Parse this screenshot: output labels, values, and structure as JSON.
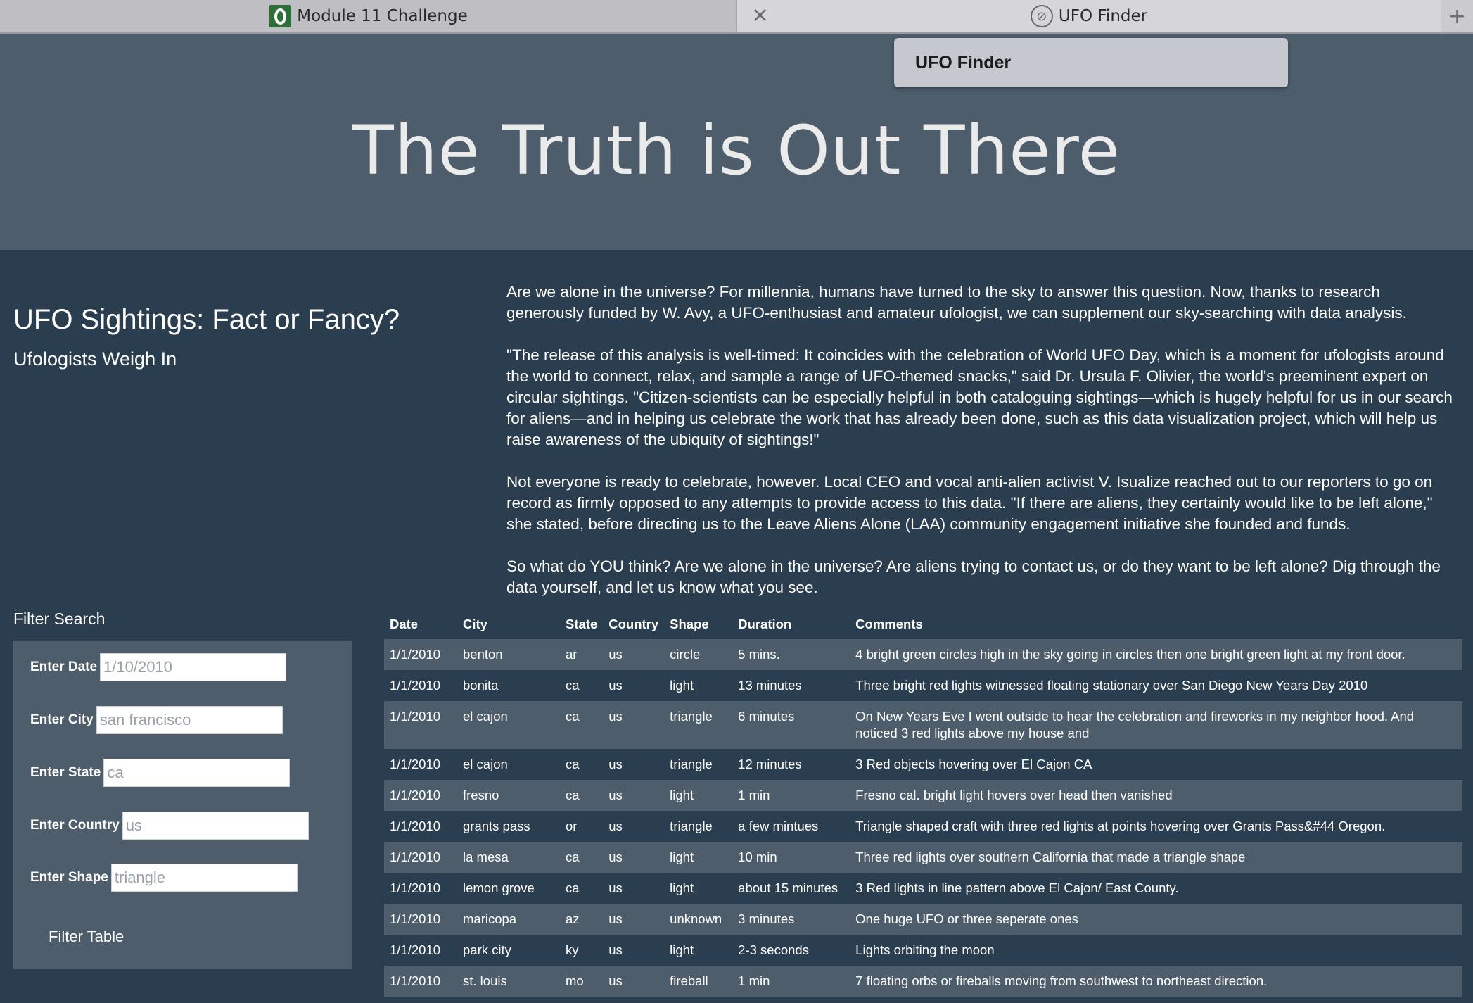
{
  "browser": {
    "tabs": [
      {
        "label": "Module 11 Challenge"
      },
      {
        "label": "UFO Finder"
      }
    ],
    "tooltip": "UFO Finder"
  },
  "hero": {
    "title": "The Truth is Out There"
  },
  "article": {
    "title": "UFO Sightings: Fact or Fancy?",
    "subtitle": "Ufologists Weigh In",
    "paragraphs": [
      "Are we alone in the universe? For millennia, humans have turned to the sky to answer this question. Now, thanks to research generously funded by W. Avy, a UFO-enthusiast and amateur ufologist, we can supplement our sky-searching with data analysis.",
      "\"The release of this analysis is well-timed: It coincides with the celebration of World UFO Day, which is a moment for ufologists around the world to connect, relax, and sample a range of UFO-themed snacks,\" said Dr. Ursula F. Olivier, the world's preeminent expert on circular sightings. \"Citizen-scientists can be especially helpful in both cataloguing sightings—which is hugely helpful for us in our search for aliens—and in helping us celebrate the work that has already been done, such as this data visualization project, which will help us raise awareness of the ubiquity of sightings!\"",
      "Not everyone is ready to celebrate, however. Local CEO and vocal anti-alien activist V. Isualize reached out to our reporters to go on record as firmly opposed to any attempts to provide access to this data. \"If there are aliens, they certainly would like to be left alone,\" she stated, before directing us to the Leave Aliens Alone (LAA) community engagement initiative she founded and funds.",
      "So what do YOU think? Are we alone in the universe? Are aliens trying to contact us, or do they want to be left alone? Dig through the data yourself, and let us know what you see."
    ]
  },
  "filters": {
    "heading": "Filter Search",
    "date": {
      "label": "Enter Date",
      "placeholder": "1/10/2010"
    },
    "city": {
      "label": "Enter City",
      "placeholder": "san francisco"
    },
    "state": {
      "label": "Enter State",
      "placeholder": "ca"
    },
    "country": {
      "label": "Enter Country",
      "placeholder": "us"
    },
    "shape": {
      "label": "Enter Shape",
      "placeholder": "triangle"
    },
    "button": "Filter Table"
  },
  "table": {
    "headers": [
      "Date",
      "City",
      "State",
      "Country",
      "Shape",
      "Duration",
      "Comments"
    ],
    "rows": [
      [
        "1/1/2010",
        "benton",
        "ar",
        "us",
        "circle",
        "5 mins.",
        "4 bright green circles high in the sky going in circles then one bright green light at my front door."
      ],
      [
        "1/1/2010",
        "bonita",
        "ca",
        "us",
        "light",
        "13 minutes",
        "Three bright red lights witnessed floating stationary over San Diego New Years Day 2010"
      ],
      [
        "1/1/2010",
        "el cajon",
        "ca",
        "us",
        "triangle",
        "6 minutes",
        "On New Years Eve I went outside to hear the celebration and fireworks in my neighbor hood. And noticed 3 red lights above my house and"
      ],
      [
        "1/1/2010",
        "el cajon",
        "ca",
        "us",
        "triangle",
        "12 minutes",
        "3 Red objects hovering over El Cajon CA"
      ],
      [
        "1/1/2010",
        "fresno",
        "ca",
        "us",
        "light",
        "1 min",
        "Fresno cal. bright light hovers over head then vanished"
      ],
      [
        "1/1/2010",
        "grants pass",
        "or",
        "us",
        "triangle",
        "a few mintues",
        "Triangle shaped craft with three red lights at points hovering over Grants Pass&#44 Oregon."
      ],
      [
        "1/1/2010",
        "la mesa",
        "ca",
        "us",
        "light",
        "10 min",
        "Three red lights over southern California that made a triangle shape"
      ],
      [
        "1/1/2010",
        "lemon grove",
        "ca",
        "us",
        "light",
        "about 15 minutes",
        "3 Red lights in line pattern above El Cajon/ East County."
      ],
      [
        "1/1/2010",
        "maricopa",
        "az",
        "us",
        "unknown",
        "3 minutes",
        "One huge UFO or three seperate ones"
      ],
      [
        "1/1/2010",
        "park city",
        "ky",
        "us",
        "light",
        "2-3 seconds",
        "Lights orbiting the moon"
      ],
      [
        "1/1/2010",
        "st. louis",
        "mo",
        "us",
        "fireball",
        "1 min",
        "7 floating orbs or fireballs moving from southwest to northeast direction."
      ]
    ]
  },
  "icons": {
    "tab1_favicon": "outlook-o-icon",
    "tab2_close": "close-icon",
    "tab2_favicon": "compass-icon",
    "new_tab": "plus-icon"
  }
}
